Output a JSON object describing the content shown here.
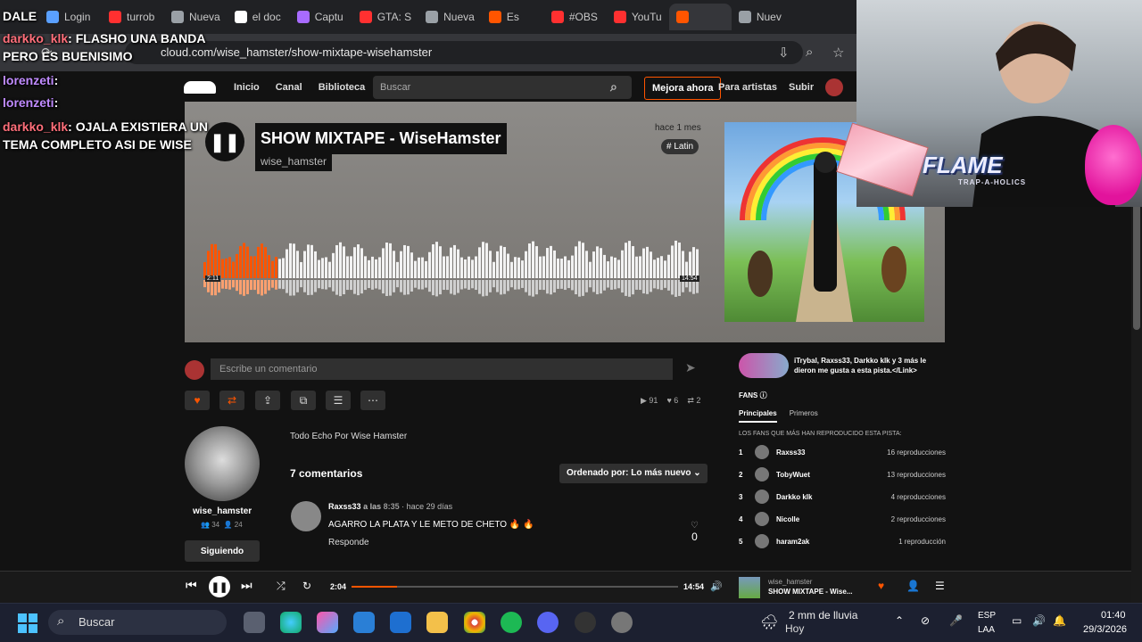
{
  "browser": {
    "tabs": [
      {
        "label": "Login",
        "color": "#5aa0ff"
      },
      {
        "label": "turrob",
        "color": "#ff3030"
      },
      {
        "label": "Nueva",
        "color": "#9aa0a6"
      },
      {
        "label": "el doc",
        "color": "#ffffff"
      },
      {
        "label": "Captu",
        "color": "#a86bff"
      },
      {
        "label": "GTA: S",
        "color": "#ff3030"
      },
      {
        "label": "Nueva",
        "color": "#9aa0a6"
      },
      {
        "label": "Es",
        "color": "#ff5500"
      },
      {
        "label": "#OBS",
        "color": "#ff3030"
      },
      {
        "label": "YouTu",
        "color": "#ff3030"
      },
      {
        "label": "",
        "color": "#ff5500",
        "active": true
      },
      {
        "label": "Nuev",
        "color": "#9aa0a6"
      }
    ],
    "url": "cloud.com/wise_hamster/show-mixtape-wisehamster"
  },
  "chat": [
    {
      "user": "",
      "text": "DALE"
    },
    {
      "user": "darkko_klk",
      "text": "FLASHO UNA BANDA"
    },
    {
      "user": "",
      "text": "PERO ES BUENISIMO"
    },
    {
      "user": "lorenzeti",
      "text": ""
    },
    {
      "user": "lorenzeti",
      "text": ""
    },
    {
      "user": "darkko_klk",
      "text": "OJALA EXISTIERA UN"
    },
    {
      "user": "",
      "text": "TEMA COMPLETO ASI DE WISE"
    }
  ],
  "soundcloud": {
    "nav": {
      "home": "Inicio",
      "feed": "Canal",
      "library": "Biblioteca",
      "search_placeholder": "Buscar",
      "upgrade": "Mejora ahora",
      "artists": "Para artistas",
      "upload": "Subir"
    },
    "track": {
      "title": "SHOW MIXTAPE - WiseHamster",
      "artist": "wise_hamster",
      "posted": "hace 1 mes",
      "tag": "# Latin",
      "wave_start": "2:11",
      "wave_end": "14:54",
      "played_fraction": 0.15
    },
    "comment_placeholder": "Escribe un comentario",
    "stats": {
      "plays": "91",
      "likes": "6",
      "reposts": "2"
    },
    "uploader": {
      "name": "wise_hamster",
      "followers": "34",
      "following": "24",
      "follow_label": "Siguiendo"
    },
    "description": "Todo Echo Por Wise Hamster",
    "comments_count": "7 comentarios",
    "sort_label": "Ordenado por: Lo más nuevo",
    "comment": {
      "user": "Raxss33",
      "at": "a las",
      "time": "8:35",
      "ago": "· hace 29 días",
      "text": "AGARRO LA PLATA Y LE METO DE CHETO 🔥 🔥",
      "reply": "Responde",
      "likes": "0"
    },
    "likers": "iTrybal, Raxss33, Darkko klk y 3 más le dieron me gusta a esta pista.</Link>",
    "fans_label": "FANS",
    "fans_tabs": [
      "Principales",
      "Primeros"
    ],
    "fans_header": "LOS FANS QUE MÁS HAN REPRODUCIDO ESTA PISTA:",
    "fans": [
      {
        "rank": "1",
        "name": "Raxss33",
        "plays": "16 reproducciones"
      },
      {
        "rank": "2",
        "name": "TobyWuet",
        "plays": "13 reproducciones"
      },
      {
        "rank": "3",
        "name": "Darkko klk",
        "plays": "4 reproducciones"
      },
      {
        "rank": "4",
        "name": "Nicolle",
        "plays": "2 reproducciones"
      },
      {
        "rank": "5",
        "name": "haram2ak",
        "plays": "1 reproducción"
      }
    ],
    "player": {
      "current": "2:04",
      "total": "14:54",
      "progress_fraction": 0.14,
      "artist": "wise_hamster",
      "title": "SHOW MIXTAPE - Wise..."
    }
  },
  "overlay": {
    "logo": "FLAME",
    "logo_sub": "TRAP-A-HOLICS"
  },
  "taskbar": {
    "search": "Buscar",
    "weather_temp": "2 mm de lluvia",
    "weather_day": "Hoy",
    "lang1": "ESP",
    "lang2": "LAA",
    "time": "01:40",
    "date": "29/3/2026"
  },
  "colors": {
    "accent": "#ff5500",
    "bg": "#121212"
  }
}
